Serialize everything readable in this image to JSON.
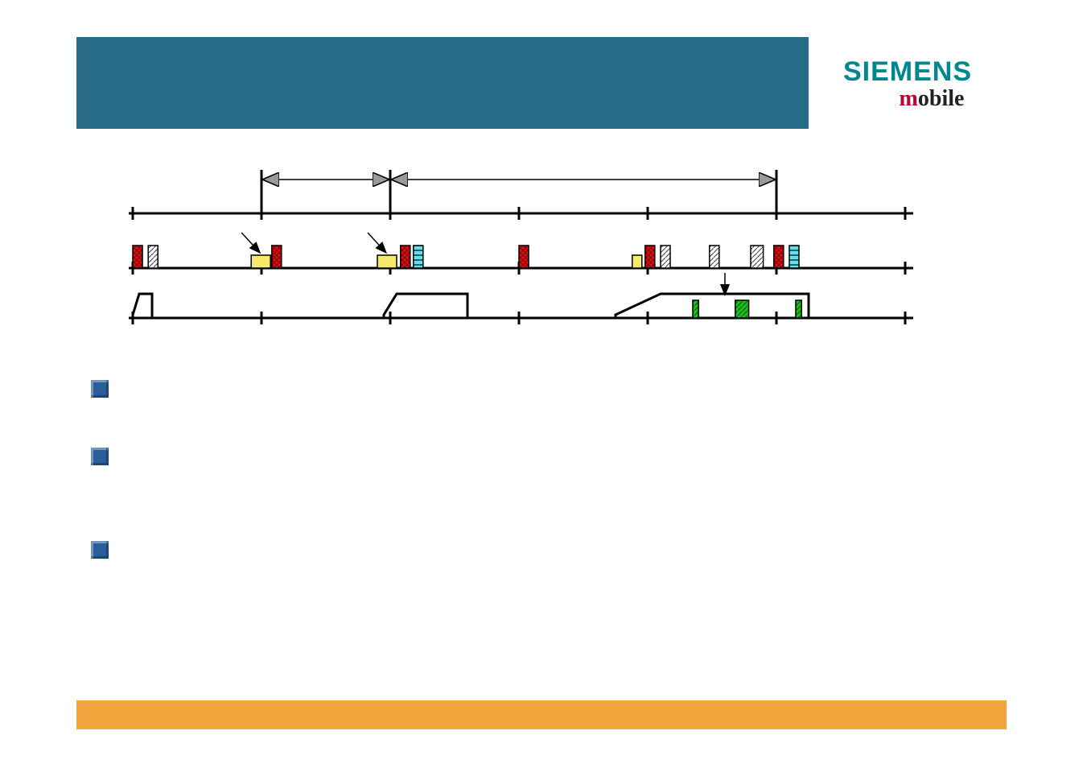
{
  "logo": {
    "siemens": "SIEMENS",
    "mobile_m": "m",
    "mobile_rest": "obile"
  },
  "chart_data": {
    "type": "timeline",
    "title": "",
    "axis_ticks": [
      0,
      1,
      2,
      3,
      4,
      5,
      6
    ],
    "arrows": [
      {
        "from_tick": 1,
        "to_tick": 2,
        "style": "double-ended"
      },
      {
        "from_tick": 2,
        "to_tick": 5,
        "style": "double-ended"
      }
    ],
    "row_middle": [
      {
        "tick": 0.0,
        "type": "red",
        "w": 1
      },
      {
        "tick": 0.12,
        "type": "hatched",
        "w": 1
      },
      {
        "tick": 0.92,
        "type": "yellow",
        "w": 2
      },
      {
        "tick": 1.08,
        "type": "red",
        "w": 1
      },
      {
        "tick": 1.9,
        "type": "yellow",
        "w": 2
      },
      {
        "tick": 2.08,
        "type": "red",
        "w": 1
      },
      {
        "tick": 2.18,
        "type": "cyan",
        "w": 1
      },
      {
        "tick": 3.0,
        "type": "red",
        "w": 1
      },
      {
        "tick": 3.88,
        "type": "yellow",
        "w": 1
      },
      {
        "tick": 3.98,
        "type": "red",
        "w": 1
      },
      {
        "tick": 4.1,
        "type": "hatched",
        "w": 1
      },
      {
        "tick": 4.48,
        "type": "hatched",
        "w": 1
      },
      {
        "tick": 4.8,
        "type": "hatched",
        "w": 1.3
      },
      {
        "tick": 4.98,
        "type": "red",
        "w": 1
      },
      {
        "tick": 5.1,
        "type": "cyan",
        "w": 1
      }
    ],
    "row_bottom_envelopes": [
      {
        "start_tick": 0.0,
        "rise": 0.05,
        "flat_end": 0.15,
        "end_tick": 0.15
      },
      {
        "start_tick": 1.95,
        "rise": 2.05,
        "flat_end": 2.6,
        "end_tick": 2.6
      },
      {
        "start_tick": 3.75,
        "rise": 4.1,
        "flat_end": 5.25,
        "end_tick": 5.25
      }
    ],
    "row_bottom_green": [
      {
        "tick": 4.35,
        "w": 0.6
      },
      {
        "tick": 4.68,
        "w": 1.4
      },
      {
        "tick": 5.15,
        "w": 0.6
      }
    ],
    "short_arrows_above_yellow": [
      1.02,
      2.0
    ],
    "down_arrow_tick": 4.6
  }
}
